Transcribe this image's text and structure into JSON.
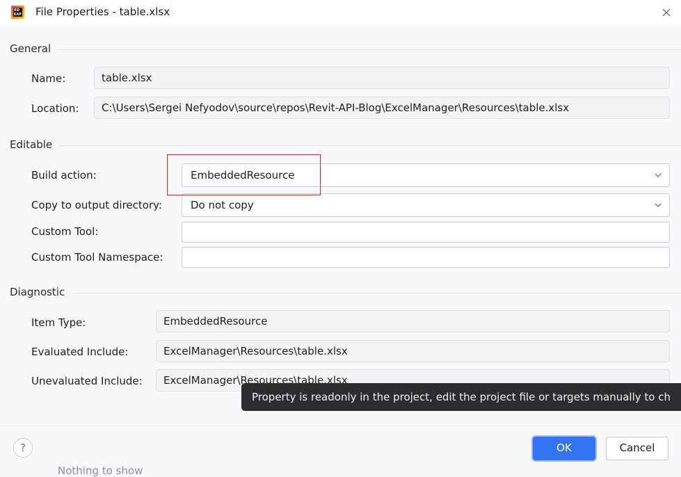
{
  "window": {
    "title": "File Properties - table.xlsx",
    "app_icon_text": "RD\nEAP"
  },
  "general": {
    "heading": "General",
    "name_label": "Name:",
    "name_value": "table.xlsx",
    "location_label": "Location:",
    "location_value": "C:\\Users\\Sergei Nefyodov\\source\\repos\\Revit-API-Blog\\ExcelManager\\Resources\\table.xlsx"
  },
  "editable": {
    "heading": "Editable",
    "build_action_label": "Build action:",
    "build_action_value": "EmbeddedResource",
    "copy_label": "Copy to output directory:",
    "copy_value": "Do not copy",
    "custom_tool_label": "Custom Tool:",
    "custom_tool_value": "",
    "custom_tool_ns_label": "Custom Tool Namespace:",
    "custom_tool_ns_value": ""
  },
  "diagnostic": {
    "heading": "Diagnostic",
    "item_type_label": "Item Type:",
    "item_type_value": "EmbeddedResource",
    "evaluated_label": "Evaluated Include:",
    "evaluated_value": "ExcelManager\\Resources\\table.xlsx",
    "unevaluated_label": "Unevaluated Include:",
    "unevaluated_value": "ExcelManager\\Resources\\table.xlsx"
  },
  "tooltip": {
    "text": "Property is readonly in the project, edit the project file or targets manually to ch"
  },
  "footer": {
    "help_label": "?",
    "ok_label": "OK",
    "cancel_label": "Cancel"
  },
  "background": {
    "text": "Nothing to show"
  },
  "colors": {
    "accent": "#3574f0",
    "highlight": "#e01e1e",
    "tooltip_bg": "#2b2d30"
  }
}
